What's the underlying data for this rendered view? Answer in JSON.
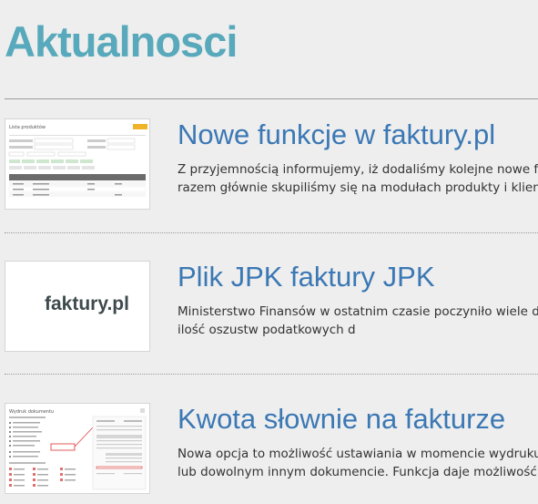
{
  "page": {
    "title": "Aktualnosci"
  },
  "articles": [
    {
      "title": "Nowe funkcje w faktury.pl",
      "excerpt_lines": [
        "Z przyjemnością informujemy, iż dodaliśmy kolejne nowe funk",
        "razem głównie skupiliśmy się na modułach produkty i klienci."
      ],
      "thumbnail": {
        "kind": "screenshot",
        "caption": "Lista produktów"
      }
    },
    {
      "title": "Plik JPK faktury JPK",
      "excerpt_lines": [
        "Ministerstwo Finansów w ostatnim czasie poczyniło wiele dzi",
        "ilość oszustw podatkowych d"
      ],
      "thumbnail": {
        "kind": "logo",
        "logo_text": "faktury.pl"
      }
    },
    {
      "title": "Kwota słownie na fakturze",
      "excerpt_lines": [
        "Nowa opcja to możliwość ustawiania w momencie wydruku, c",
        "lub dowolnym innym dokumencie.  Funkcja daje możliwość wy"
      ],
      "thumbnail": {
        "kind": "screenshot",
        "caption": "Wydruk dokumentu"
      }
    }
  ],
  "colors": {
    "title": "#58a9bb",
    "headline": "#3b78b4",
    "text": "#333333",
    "background": "#eeeeee"
  }
}
